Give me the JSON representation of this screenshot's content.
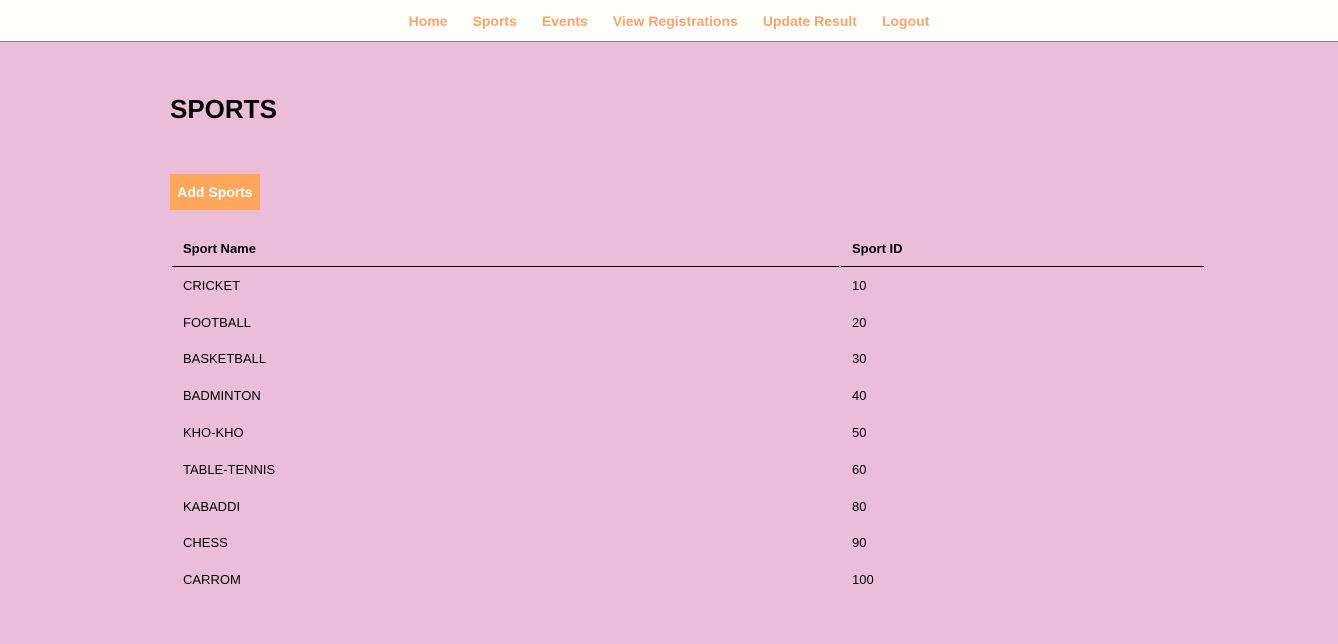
{
  "nav": {
    "items": [
      "Home",
      "Sports",
      "Events",
      "View Registrations",
      "Update Result",
      "Logout"
    ]
  },
  "page": {
    "title": "SPORTS",
    "add_button": "Add Sports"
  },
  "table": {
    "headers": [
      "Sport Name",
      "Sport ID"
    ],
    "rows": [
      [
        "CRICKET",
        "10"
      ],
      [
        "FOOTBALL",
        "20"
      ],
      [
        "BASKETBALL",
        "30"
      ],
      [
        "BADMINTON",
        "40"
      ],
      [
        "KHO-KHO",
        "50"
      ],
      [
        "TABLE-TENNIS",
        "60"
      ],
      [
        "KABADDI",
        "80"
      ],
      [
        "CHESS",
        "90"
      ],
      [
        "CARROM",
        "100"
      ]
    ]
  },
  "colors": {
    "accent": "#ffa75d",
    "background": "#eabdd8",
    "nav_link": "#f8a46e"
  }
}
